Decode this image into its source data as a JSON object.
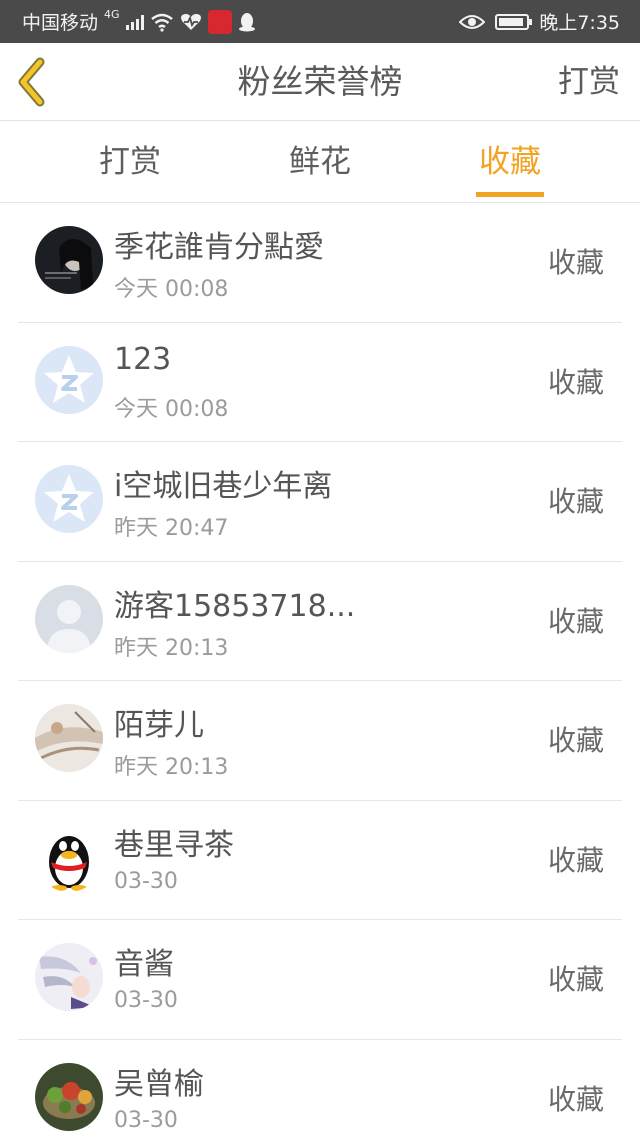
{
  "statusbar": {
    "carrier": "中国移动",
    "network": "4G",
    "time": "晚上7:35"
  },
  "navbar": {
    "title": "粉丝荣誉榜",
    "right_action": "打赏"
  },
  "tabs": [
    {
      "label": "打赏",
      "active": false
    },
    {
      "label": "鲜花",
      "active": false
    },
    {
      "label": "收藏",
      "active": true
    }
  ],
  "colors": {
    "accent": "#f3a323",
    "status_bar": "#4a4a4a"
  },
  "fans": [
    {
      "name": "季花誰肯分點愛",
      "time": "今天 00:08",
      "action": "收藏",
      "avatar": "photo-avatar-dark-portrait"
    },
    {
      "name": "123",
      "time": "今天 00:08",
      "action": "收藏",
      "avatar": "qzone-star-avatar"
    },
    {
      "name": "i空城旧巷少年离",
      "time": "昨天 20:47",
      "action": "收藏",
      "avatar": "qzone-star-avatar"
    },
    {
      "name": "游客15853718...",
      "time": "昨天 20:13",
      "action": "收藏",
      "avatar": "default-person-avatar"
    },
    {
      "name": "陌芽儿",
      "time": "昨天 20:13",
      "action": "收藏",
      "avatar": "photo-avatar-light"
    },
    {
      "name": "巷里寻茶",
      "time": "03-30",
      "action": "收藏",
      "avatar": "qq-penguin-avatar"
    },
    {
      "name": "音酱",
      "time": "03-30",
      "action": "收藏",
      "avatar": "anime-avatar"
    },
    {
      "name": "吴曾榆",
      "time": "03-30",
      "action": "收藏",
      "avatar": "photo-avatar-food"
    }
  ]
}
